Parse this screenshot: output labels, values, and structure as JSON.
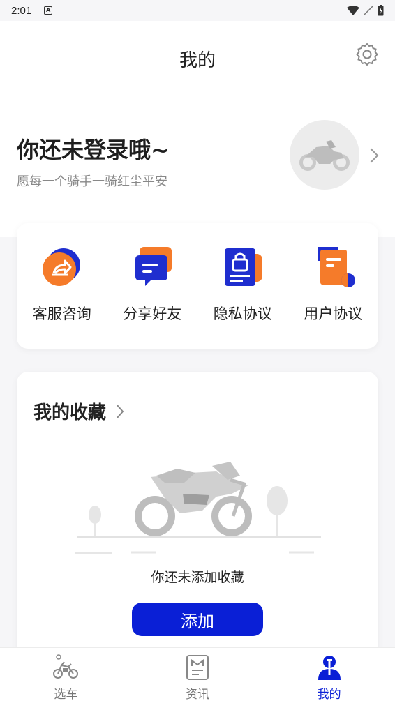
{
  "status_bar": {
    "time": "2:01",
    "badge": "A"
  },
  "header": {
    "title": "我的",
    "settings_icon": "gear-icon"
  },
  "login": {
    "title": "你还未登录哦~",
    "subtitle": "愿每一个骑手一骑红尘平安",
    "avatar_icon": "motorcycle-icon"
  },
  "services": [
    {
      "label": "客服咨询",
      "icon": "customer-service-icon"
    },
    {
      "label": "分享好友",
      "icon": "share-message-icon"
    },
    {
      "label": "隐私协议",
      "icon": "privacy-lock-icon"
    },
    {
      "label": "用户协议",
      "icon": "user-agreement-icon"
    }
  ],
  "favorites": {
    "title": "我的收藏",
    "empty_text": "你还未添加收藏",
    "add_label": "添加"
  },
  "tabbar": {
    "tabs": [
      {
        "label": "选车",
        "icon": "motorcycle-tab-icon",
        "active": false
      },
      {
        "label": "资讯",
        "icon": "news-icon",
        "active": false
      },
      {
        "label": "我的",
        "icon": "profile-icon",
        "active": true
      }
    ]
  },
  "colors": {
    "accent": "#0a1fd6",
    "orange": "#f47b20"
  }
}
